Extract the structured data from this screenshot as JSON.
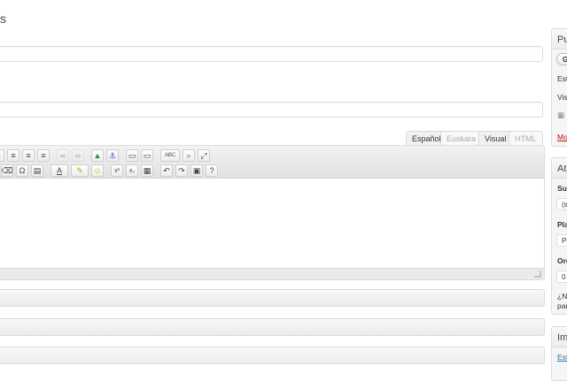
{
  "page": {
    "top_fragment": "s"
  },
  "title_field": {
    "value": ""
  },
  "second_field": {
    "value": ""
  },
  "editor": {
    "tabs": [
      {
        "label": "Español",
        "state": "active"
      },
      {
        "label": "Euskara",
        "state": "inactive"
      },
      {
        "label": "Visual",
        "state": "active"
      },
      {
        "label": "HTML",
        "state": "inactive"
      }
    ],
    "toolbar_row1_icons": [
      "bullets-icon",
      "align-left-icon",
      "align-center-icon",
      "align-right-icon",
      "link-icon",
      "unlink-icon",
      "image-icon",
      "anchor-icon",
      "page-break-icon",
      "print-icon",
      "spellcheck-icon",
      "find-icon",
      "fullscreen-icon"
    ],
    "toolbar_row2_icons": [
      "eraser-icon",
      "omega-icon",
      "paste-word-icon",
      "font-color-icon",
      "highlight-icon",
      "smiley-icon",
      "superscript-icon",
      "subscript-icon",
      "media-icon",
      "undo-icon",
      "redo-icon",
      "insert-icon",
      "help-icon"
    ],
    "labels": {
      "spell": "ABC",
      "omega": "Ω",
      "sup": "x²",
      "sub": "x₂",
      "font_a": "A",
      "help": "?"
    }
  },
  "sidebar": {
    "publish": {
      "title": "Pu",
      "save_label": "G",
      "status": "Est",
      "visibility": "Visi",
      "move_trash": "Mo"
    },
    "attributes": {
      "title": "Atr",
      "parent_label": "Sup",
      "parent_value": "(s",
      "template_label": "Pla",
      "template_value": "Pl",
      "order_label": "Ord",
      "order_value": "0",
      "help_line1": "¿Ne",
      "help_line2": "pan"
    },
    "featured_image": {
      "title": "Im",
      "set_link": "Est"
    }
  },
  "colors": {
    "link": "#21759b",
    "trash": "#bc0b0b",
    "border": "#dcdcdc"
  }
}
